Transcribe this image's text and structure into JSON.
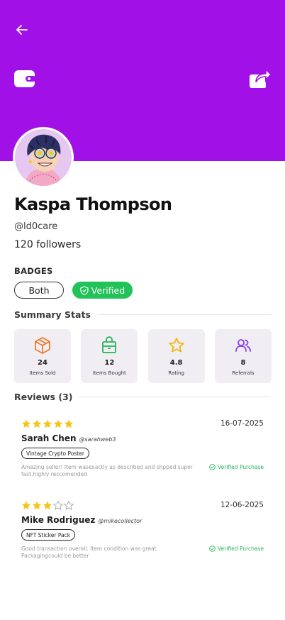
{
  "header": {
    "background_color": "#a210e8",
    "back_icon": "arrow-left-icon",
    "wallet_icon": "wallet-icon",
    "share_icon": "share-icon"
  },
  "profile": {
    "name": "Kaspa Thompson",
    "handle": "@ld0care",
    "followers": "120 followers"
  },
  "badges": {
    "label": "BADGES",
    "items": [
      {
        "label": "Both"
      },
      {
        "label": "Verified",
        "color": "#22c25a",
        "icon": "shield-check-icon"
      }
    ]
  },
  "summary": {
    "title": "Summary Stats",
    "stats": [
      {
        "value": "24",
        "label": "Items Sold",
        "icon": "box-icon",
        "color": "#f07a2a"
      },
      {
        "value": "12",
        "label": "Items Bought",
        "icon": "shopping-bag-icon",
        "color": "#22b556"
      },
      {
        "value": "4.8",
        "label": "Rating",
        "icon": "star-icon",
        "color": "#f2b705"
      },
      {
        "value": "8",
        "label": "Referrals",
        "icon": "users-icon",
        "color": "#8a3ff0"
      }
    ]
  },
  "reviews": {
    "title": "Reviews (3)",
    "items": [
      {
        "rating": 5,
        "date": "16-07-2025",
        "name": "Sarah Chen",
        "handle": "@sarahweb3",
        "product": "Vintage Crypto Poster",
        "comment": "Amazing seller! Item wasexactly as described and shpped super fast.highly reccomended",
        "verified": "Verified Purchase"
      },
      {
        "rating": 3,
        "date": "12-06-2025",
        "name": "Mike Rodriguez",
        "handle": "@mikecollector",
        "product": "NFT Sticker Pack",
        "comment": "Good transaction overall. Item condition was great. Packagingcould be better",
        "verified": "Verified Purchase"
      }
    ]
  }
}
